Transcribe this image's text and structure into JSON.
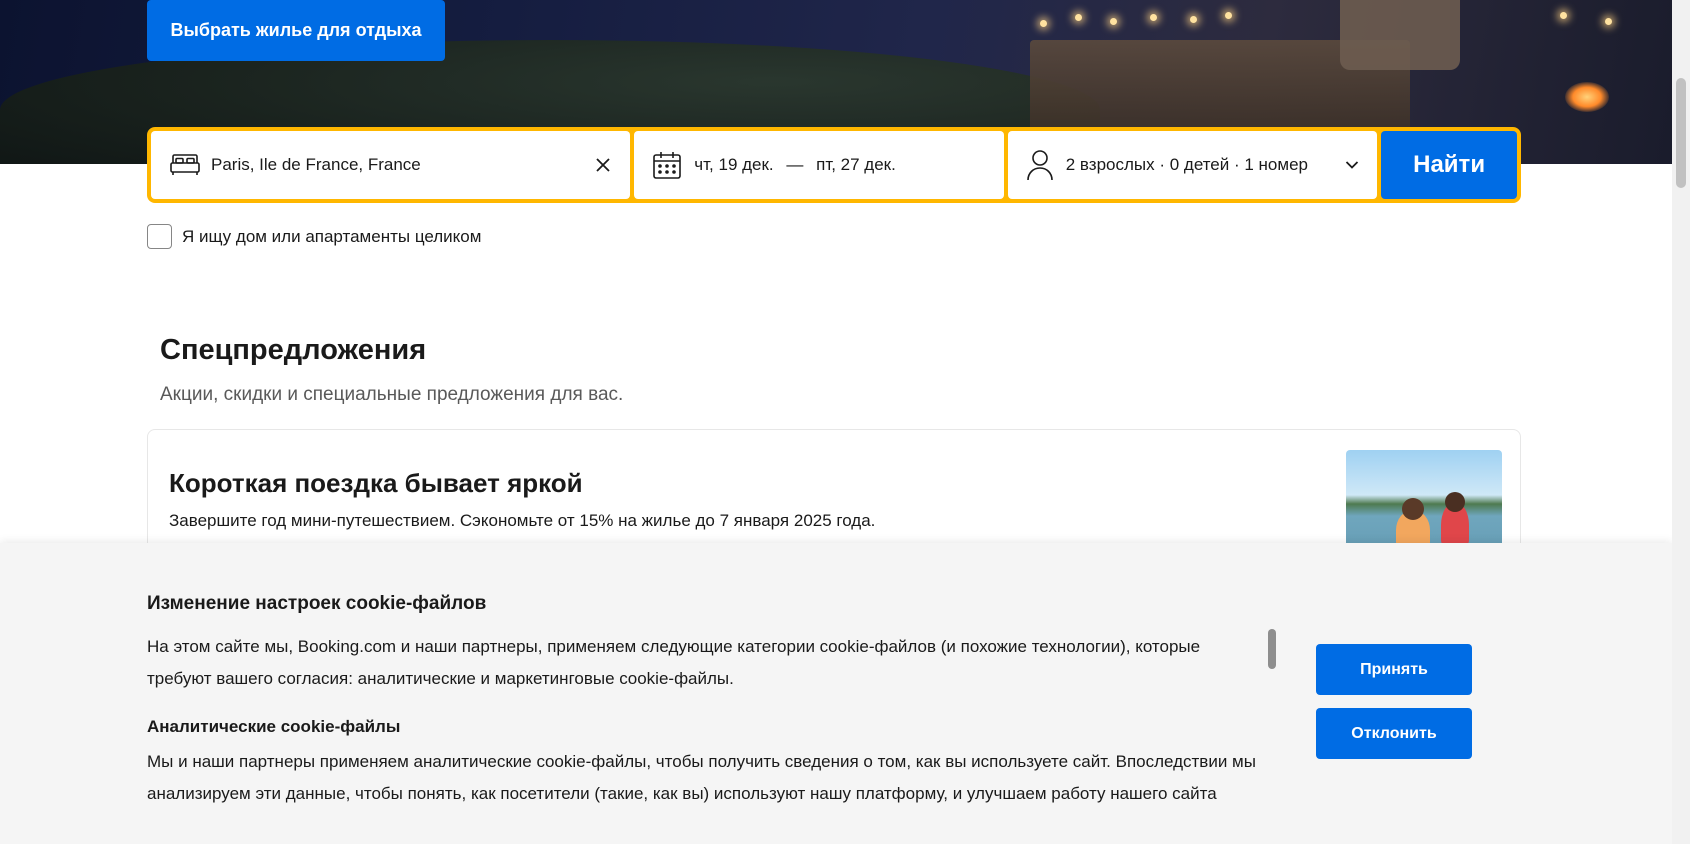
{
  "hero": {
    "cta_label": "Выбрать жилье для отдыха"
  },
  "search": {
    "destination_value": "Paris, Ile de France, France",
    "date_from": "чт, 19 дек.",
    "date_sep": "—",
    "date_to": "пт, 27 дек.",
    "guests_value": "2 взрослых · 0 детей · 1 номер",
    "submit_label": "Найти",
    "whole_home_label": "Я ищу дом или апартаменты целиком",
    "bar_color": "#ffb700",
    "accent_color": "#006ce4"
  },
  "offers": {
    "title": "Спецпредложения",
    "subtitle": "Акции, скидки и специальные предложения для вас.",
    "card": {
      "title": "Короткая поездка бывает яркой",
      "text": "Завершите год мини-путешествием. Сэкономьте от 15% на жилье до 7 января 2025 года."
    }
  },
  "cookie": {
    "title": "Изменение настроек cookie-файлов",
    "intro": "На этом сайте мы, Booking.com и наши партнеры, применяем следующие категории cookie-файлов (и похожие технологии), которые требуют вашего согласия: аналитические и маркетинговые cookie-файлы.",
    "analytics_title": "Аналитические cookie-файлы",
    "analytics_text": "Мы и наши партнеры применяем аналитические cookie-файлы, чтобы получить сведения о том, как вы используете сайт. Впоследствии мы анализируем эти данные, чтобы понять, как посетители (такие, как вы) используют нашу платформу, и улучшаем работу нашего сайта",
    "accept_label": "Принять",
    "decline_label": "Отклонить"
  },
  "icons": {
    "bed": "bed-icon",
    "clear": "close-icon",
    "calendar": "calendar-icon",
    "person": "person-icon",
    "chevron": "chevron-down-icon"
  }
}
